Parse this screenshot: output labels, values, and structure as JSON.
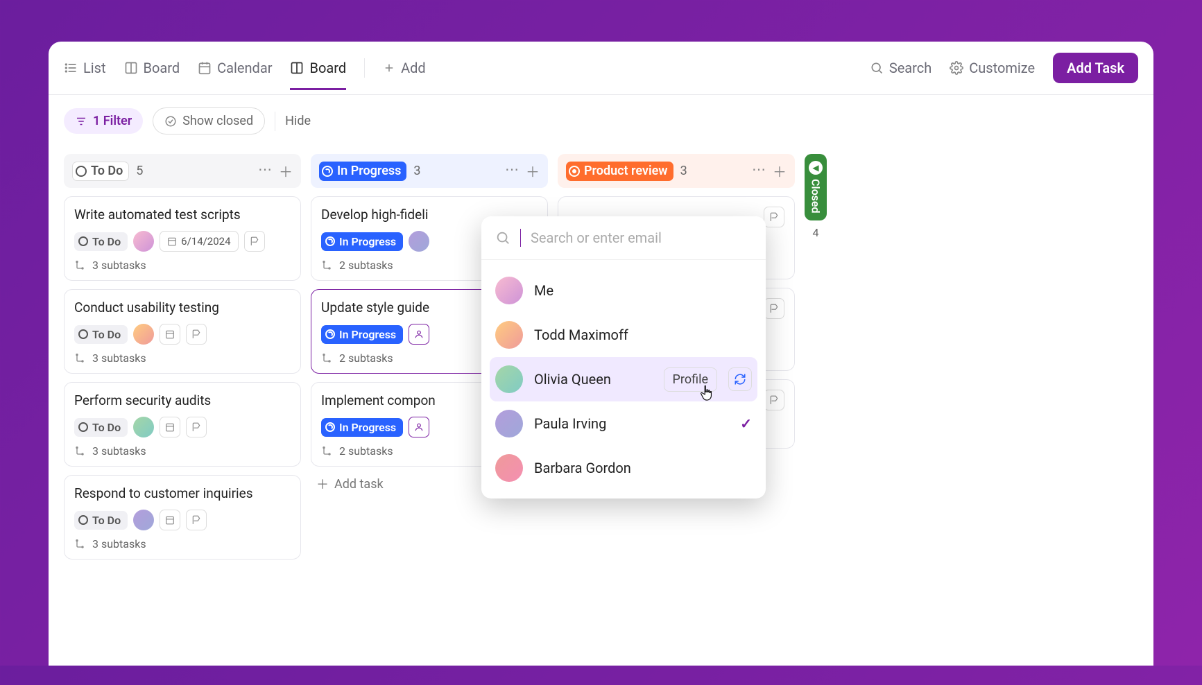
{
  "header": {
    "view_list": "List",
    "view_board1": "Board",
    "view_calendar": "Calendar",
    "view_board2": "Board",
    "add": "Add",
    "search": "Search",
    "customize": "Customize",
    "add_task_btn": "Add Task"
  },
  "filters": {
    "filter_pill": "1 Filter",
    "show_closed": "Show closed",
    "hide": "Hide"
  },
  "columns": {
    "todo": {
      "label": "To Do",
      "count": "5"
    },
    "inprogress": {
      "label": "In Progress",
      "count": "3"
    },
    "review": {
      "label": "Product review",
      "count": "3"
    },
    "closed": {
      "label": "Closed",
      "count": "4"
    }
  },
  "todo_cards": [
    {
      "title": "Write automated test scripts",
      "status": "To Do",
      "date": "6/14/2024",
      "subtasks": "3 subtasks"
    },
    {
      "title": "Conduct usability testing",
      "status": "To Do",
      "subtasks": "3 subtasks"
    },
    {
      "title": "Perform security audits",
      "status": "To Do",
      "subtasks": "3 subtasks"
    },
    {
      "title": "Respond to customer inquiries",
      "status": "To Do",
      "subtasks": "3 subtasks"
    }
  ],
  "inprogress_cards": [
    {
      "title": "Develop high-fideli",
      "status": "In Progress",
      "subtasks": "2 subtasks"
    },
    {
      "title": "Update style guide",
      "status": "In Progress",
      "subtasks": "2 subtasks"
    },
    {
      "title": "Implement compon",
      "status": "In Progress",
      "subtasks": "2 subtasks"
    }
  ],
  "add_task_label": "Add task",
  "popover": {
    "placeholder": "Search or enter email",
    "profile_btn": "Profile",
    "people": [
      {
        "name": "Me"
      },
      {
        "name": "Todd Maximoff"
      },
      {
        "name": "Olivia Queen",
        "hovered": true
      },
      {
        "name": "Paula Irving",
        "checked": true
      },
      {
        "name": "Barbara Gordon"
      }
    ]
  }
}
